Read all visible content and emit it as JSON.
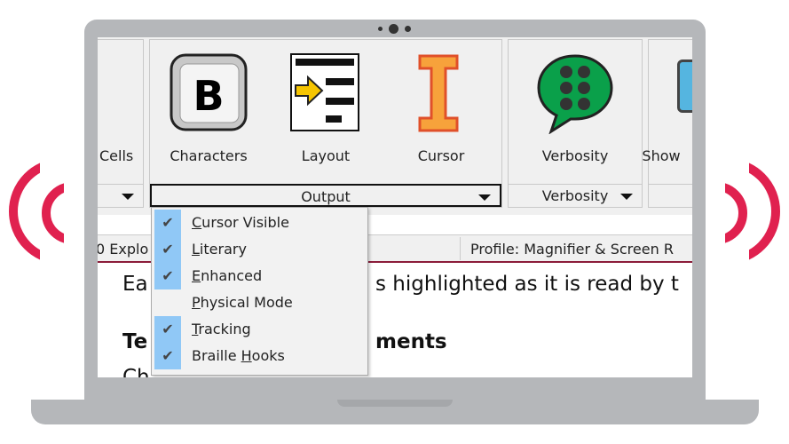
{
  "ribbon": {
    "partial_left_label": "Cells",
    "output_group": {
      "label": "Output",
      "buttons": [
        {
          "label": "Characters",
          "icon": "braille-b-icon"
        },
        {
          "label": "Layout",
          "icon": "layout-arrow-icon"
        },
        {
          "label": "Cursor",
          "icon": "cursor-i-beam-icon"
        }
      ]
    },
    "verbosity_group": {
      "label": "Verbosity",
      "buttons": [
        {
          "label": "Verbosity",
          "icon": "braille-speech-bubble-icon"
        }
      ]
    },
    "partial_right_label": "Show"
  },
  "menu": {
    "items": [
      {
        "label": "Cursor Visible",
        "mnemonic": "C",
        "checked": true
      },
      {
        "label": "Literary",
        "mnemonic": "L",
        "checked": true
      },
      {
        "label": "Enhanced",
        "mnemonic": "E",
        "checked": true
      },
      {
        "label": "Physical Mode",
        "mnemonic": "P",
        "checked": false
      },
      {
        "label": "Tracking",
        "mnemonic": "T",
        "checked": true
      },
      {
        "label": "Braille Hooks",
        "mnemonic": "H",
        "checked": true
      }
    ]
  },
  "status": {
    "left": "0 Explo",
    "profile": "Profile: Magnifier & Screen R"
  },
  "document": {
    "line1_a": "Ea",
    "line1_b": "s highlighted as it is read by t",
    "heading_a": "Te",
    "heading_b": "ments",
    "line3": "Ch"
  },
  "colors": {
    "accent": "#8b1c3a",
    "highlight": "#90c8f6",
    "waves": "#e0214f"
  }
}
